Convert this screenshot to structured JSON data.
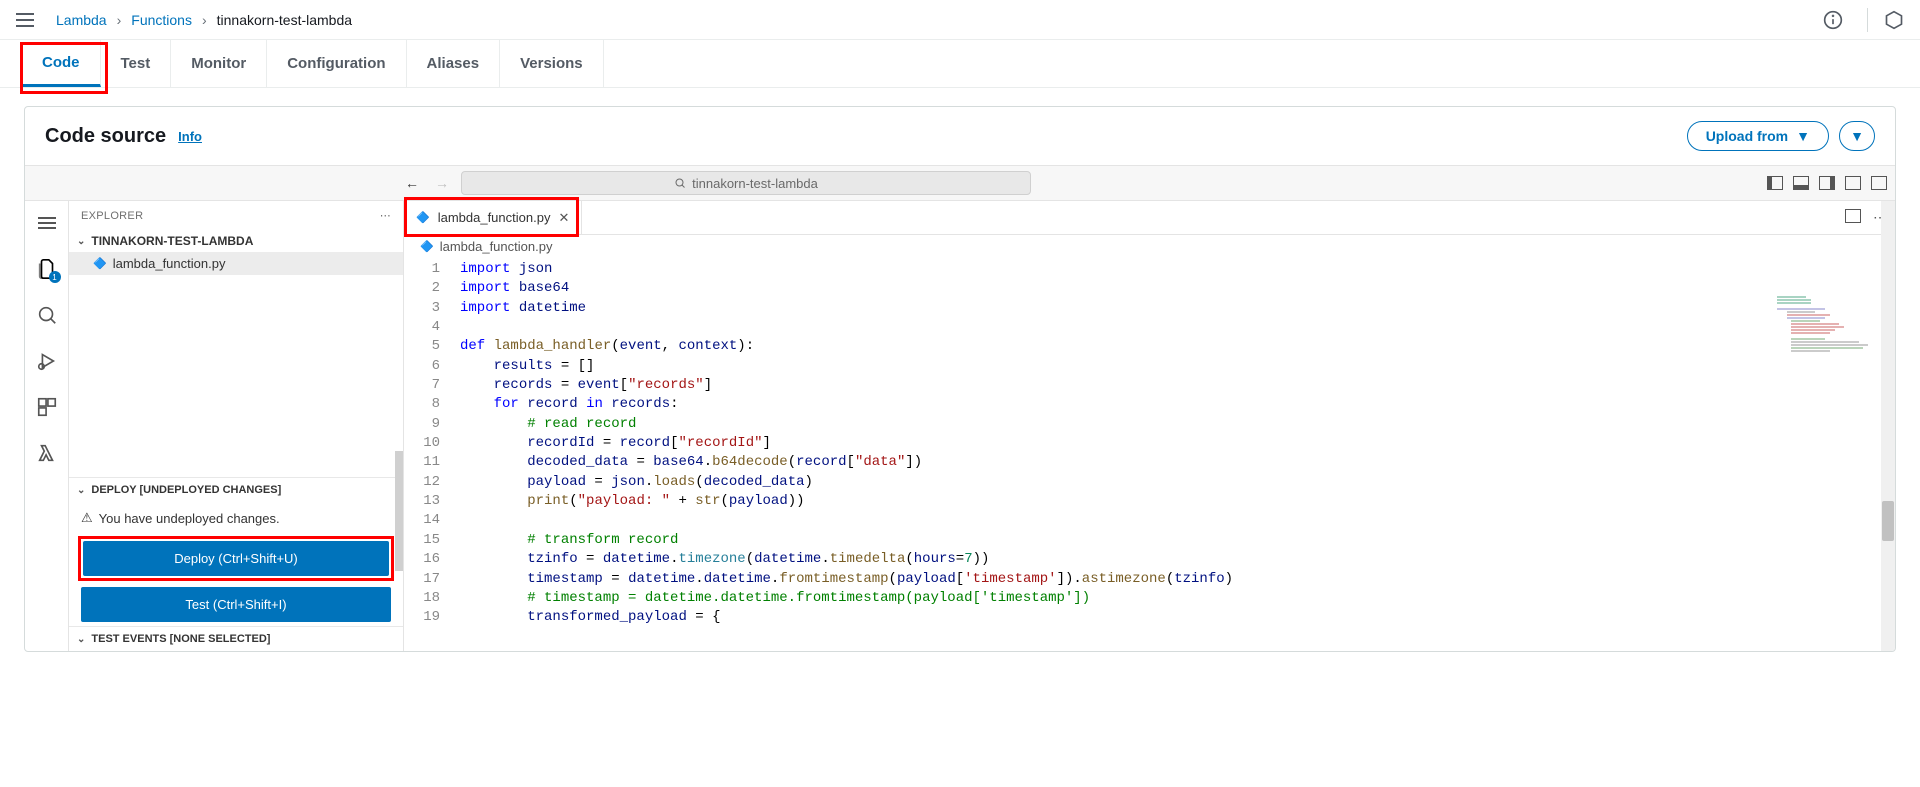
{
  "breadcrumb": {
    "root": "Lambda",
    "mid": "Functions",
    "current": "tinnakorn-test-lambda"
  },
  "top_icons": {
    "info": "info-icon",
    "hex": "hexagon-icon"
  },
  "tabs": [
    "Code",
    "Test",
    "Monitor",
    "Configuration",
    "Aliases",
    "Versions"
  ],
  "active_tab": "Code",
  "card": {
    "title": "Code source",
    "info": "Info",
    "upload": "Upload from"
  },
  "ide": {
    "search_text": "tinnakorn-test-lambda",
    "explorer_label": "EXPLORER",
    "project_name": "TINNAKORN-TEST-LAMBDA",
    "file_name": "lambda_function.py",
    "deploy": {
      "header": "DEPLOY [UNDEPLOYED CHANGES]",
      "message": "You have undeployed changes.",
      "deploy_btn": "Deploy (Ctrl+Shift+U)",
      "test_btn": "Test (Ctrl+Shift+I)"
    },
    "test_events_header": "TEST EVENTS [NONE SELECTED]",
    "editor": {
      "tab_file": "lambda_function.py",
      "crumb_file": "lambda_function.py",
      "lines": [
        {
          "n": 1,
          "html": "<span class=\"kw\">import</span> <span class=\"var\">json</span>"
        },
        {
          "n": 2,
          "html": "<span class=\"kw\">import</span> <span class=\"var\">base64</span>"
        },
        {
          "n": 3,
          "html": "<span class=\"kw\">import</span> <span class=\"var\">datetime</span>"
        },
        {
          "n": 4,
          "html": ""
        },
        {
          "n": 5,
          "html": "<span class=\"kw\">def</span> <span class=\"fn\">lambda_handler</span>(<span class=\"var\">event</span>, <span class=\"var\">context</span>):"
        },
        {
          "n": 6,
          "html": "    <span class=\"var\">results</span> = []"
        },
        {
          "n": 7,
          "html": "    <span class=\"var\">records</span> = <span class=\"var\">event</span>[<span class=\"str\">\"records\"</span>]"
        },
        {
          "n": 8,
          "html": "    <span class=\"kw\">for</span> <span class=\"var\">record</span> <span class=\"kw\">in</span> <span class=\"var\">records</span>:"
        },
        {
          "n": 9,
          "html": "        <span class=\"com\"># read record</span>"
        },
        {
          "n": 10,
          "html": "        <span class=\"var\">recordId</span> = <span class=\"var\">record</span>[<span class=\"str\">\"recordId\"</span>]"
        },
        {
          "n": 11,
          "html": "        <span class=\"var\">decoded_data</span> = <span class=\"var\">base64</span>.<span class=\"fn\">b64decode</span>(<span class=\"var\">record</span>[<span class=\"str\">\"data\"</span>])"
        },
        {
          "n": 12,
          "html": "        <span class=\"var\">payload</span> = <span class=\"var\">json</span>.<span class=\"fn\">loads</span>(<span class=\"var\">decoded_data</span>)"
        },
        {
          "n": 13,
          "html": "        <span class=\"fn\">print</span>(<span class=\"str\">\"payload: \"</span> + <span class=\"fn\">str</span>(<span class=\"var\">payload</span>))"
        },
        {
          "n": 14,
          "html": ""
        },
        {
          "n": 15,
          "html": "        <span class=\"com\"># transform record</span>"
        },
        {
          "n": 16,
          "html": "        <span class=\"var\">tzinfo</span> = <span class=\"var\">datetime</span>.<span class=\"cls\">timezone</span>(<span class=\"var\">datetime</span>.<span class=\"fn\">timedelta</span>(<span class=\"var\">hours</span>=<span class=\"num\">7</span>))"
        },
        {
          "n": 17,
          "html": "        <span class=\"var\">timestamp</span> = <span class=\"var\">datetime</span>.<span class=\"var\">datetime</span>.<span class=\"fn\">fromtimestamp</span>(<span class=\"var\">payload</span>[<span class=\"str\">'timestamp'</span>]).<span class=\"fn\">astimezone</span>(<span class=\"var\">tzinfo</span>)"
        },
        {
          "n": 18,
          "html": "        <span class=\"com\"># timestamp = datetime.datetime.fromtimestamp(payload['timestamp'])</span>"
        },
        {
          "n": 19,
          "html": "        <span class=\"var\">transformed_payload</span> = {"
        }
      ]
    }
  }
}
